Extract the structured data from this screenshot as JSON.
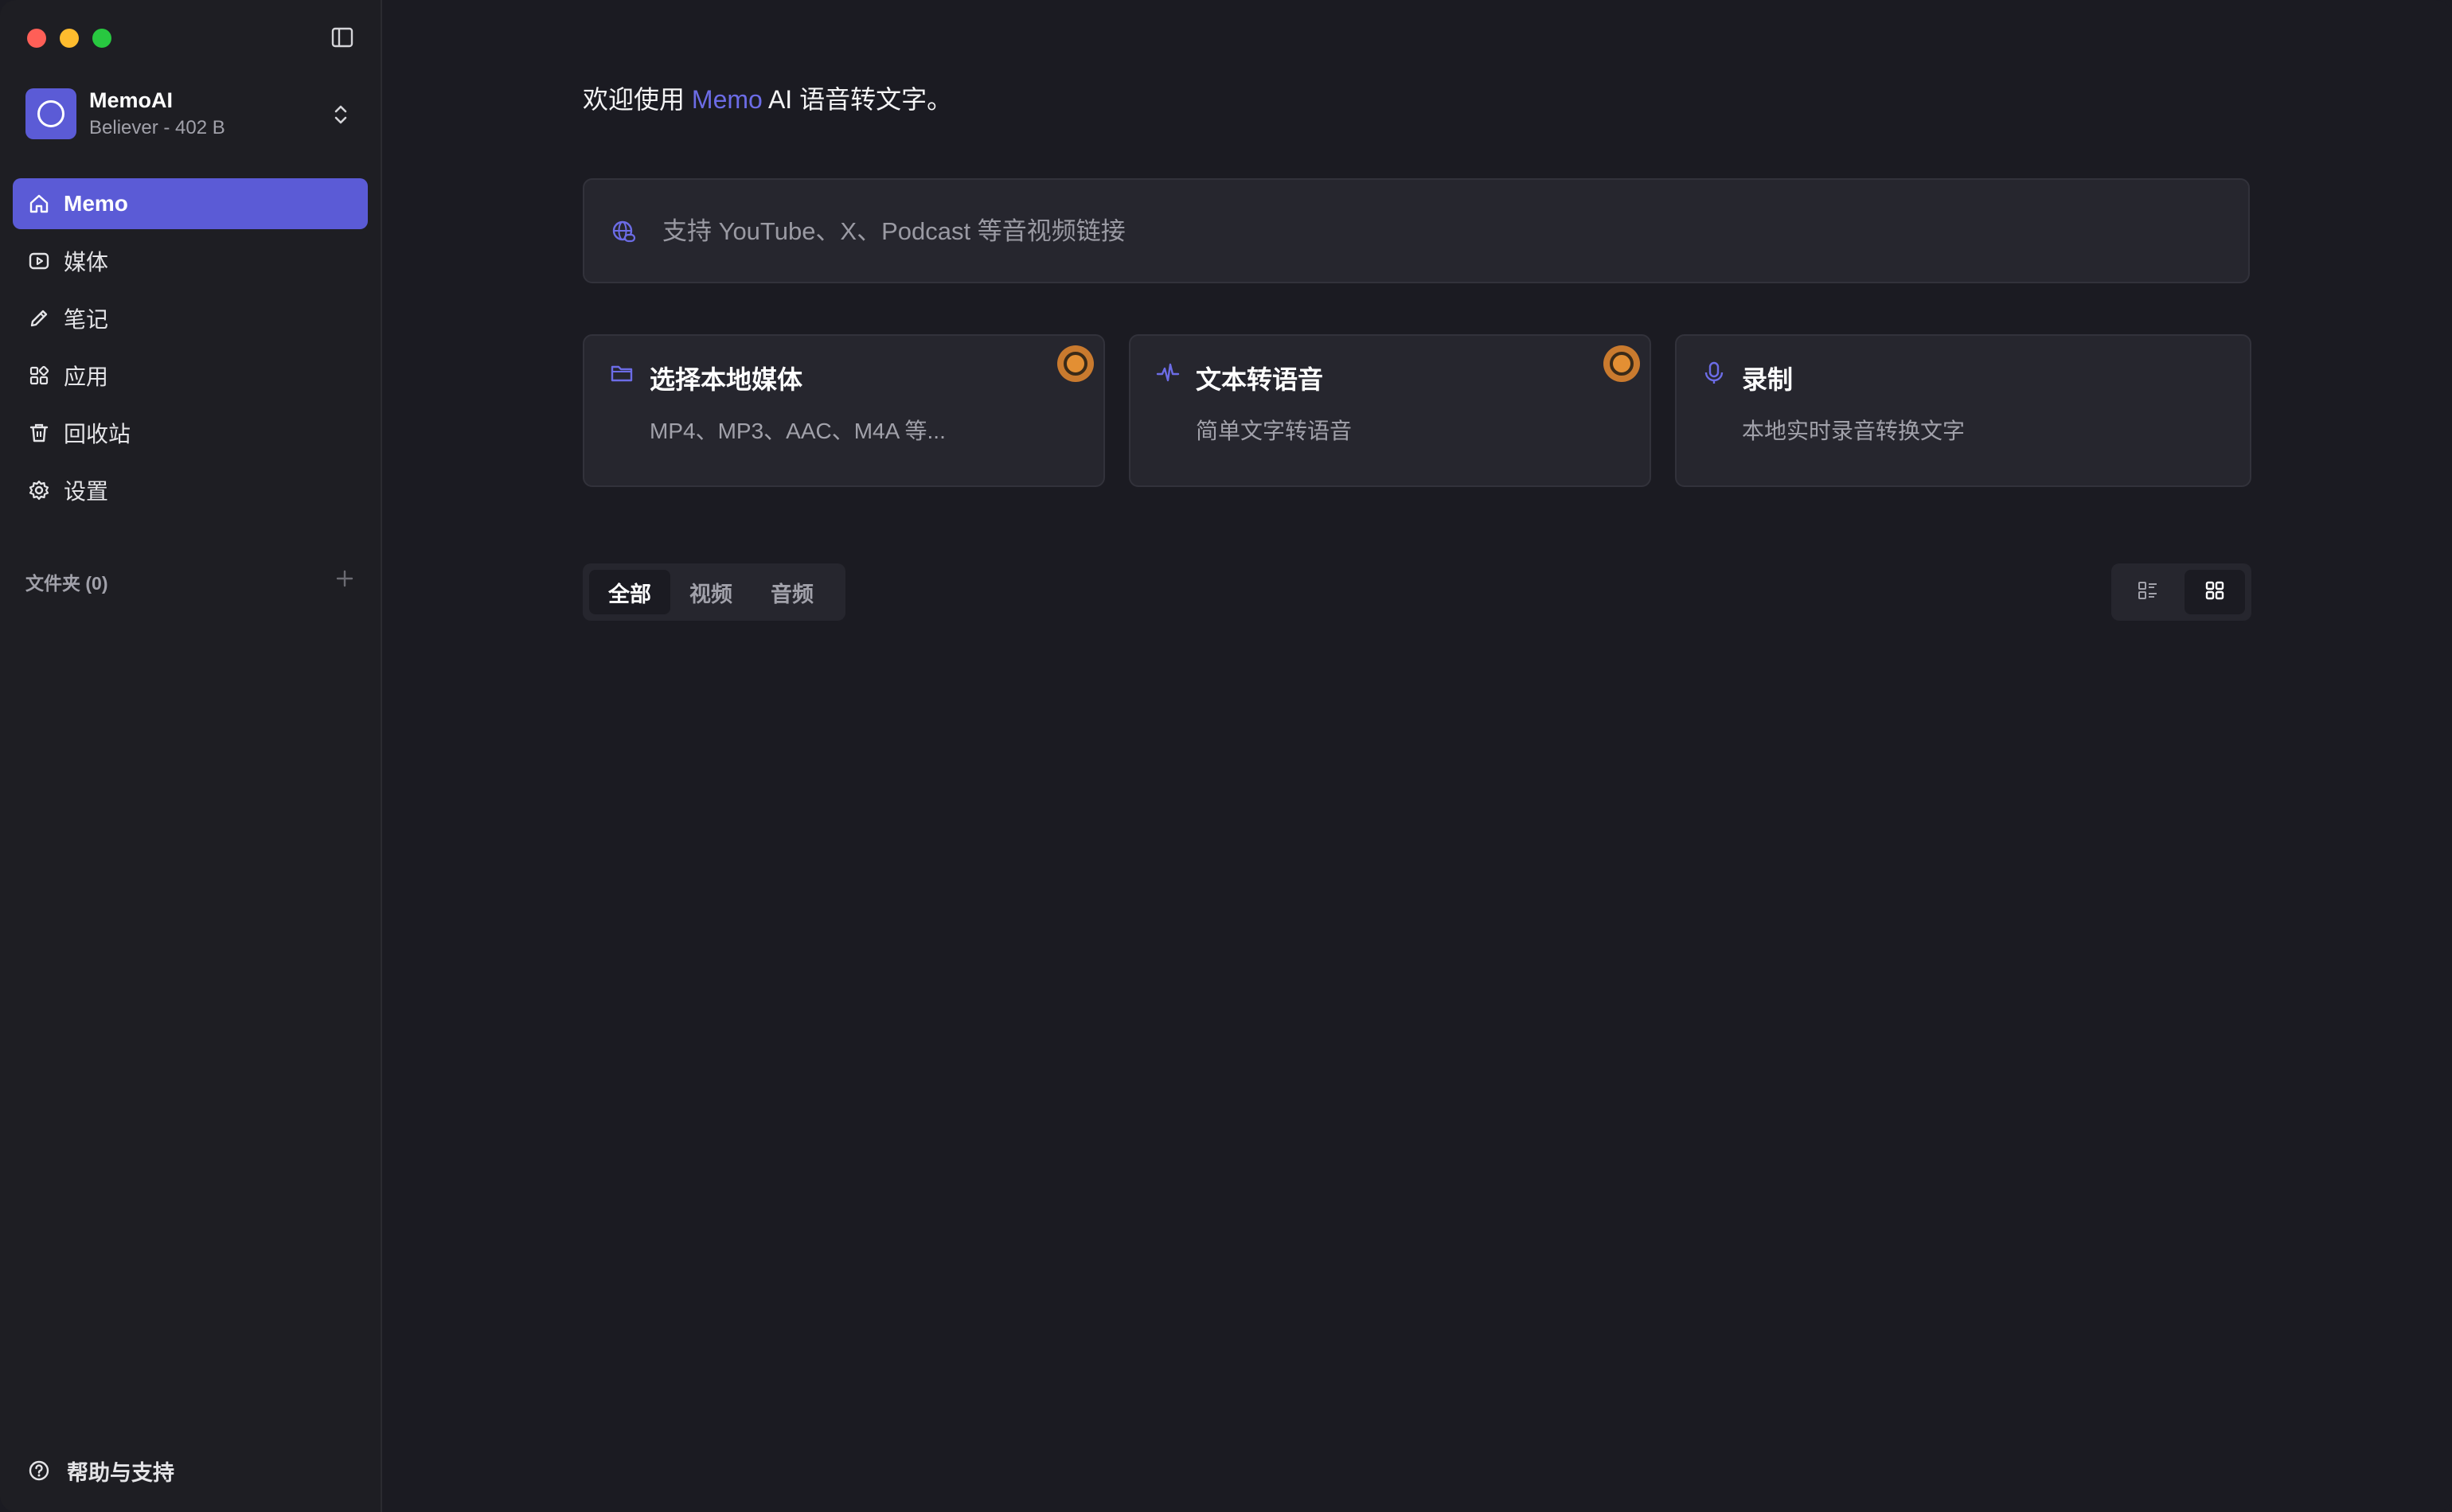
{
  "window": {
    "controls": [
      "close",
      "minimize",
      "maximize"
    ]
  },
  "sidebar": {
    "toggle_icon": "sidebar-toggle-icon",
    "account": {
      "name": "MemoAI",
      "subtitle": "Believer - 402 B"
    },
    "nav": [
      {
        "label": "Memo",
        "icon": "home-icon",
        "active": true
      },
      {
        "label": "媒体",
        "icon": "play-square-icon",
        "active": false
      },
      {
        "label": "笔记",
        "icon": "pencil-icon",
        "active": false
      },
      {
        "label": "应用",
        "icon": "apps-grid-icon",
        "active": false
      },
      {
        "label": "回收站",
        "icon": "trash-icon",
        "active": false
      },
      {
        "label": "设置",
        "icon": "gear-icon",
        "active": false
      }
    ],
    "folders": {
      "label": "文件夹 (0)"
    },
    "help": {
      "label": "帮助与支持"
    }
  },
  "main": {
    "welcome": {
      "prefix": "欢迎使用 ",
      "brand": "Memo",
      "suffix": " AI 语音转文字。"
    },
    "url_input": {
      "placeholder": "支持 YouTube、X、Podcast 等音视频链接",
      "value": ""
    },
    "cards": [
      {
        "title": "选择本地媒体",
        "desc": "MP4、MP3、AAC、M4A 等...",
        "icon": "folder-icon",
        "badge": true
      },
      {
        "title": "文本转语音",
        "desc": "简单文字转语音",
        "icon": "waveform-icon",
        "badge": true
      },
      {
        "title": "录制",
        "desc": "本地实时录音转换文字",
        "icon": "microphone-icon",
        "badge": false
      }
    ],
    "filter_tabs": [
      {
        "label": "全部",
        "active": true
      },
      {
        "label": "视频",
        "active": false
      },
      {
        "label": "音频",
        "active": false
      }
    ],
    "view_modes": [
      {
        "icon": "list-view-icon",
        "active": false
      },
      {
        "icon": "grid-view-icon",
        "active": true
      }
    ]
  },
  "colors": {
    "accent": "#5b5bd6",
    "accent_text": "#6c6ce6",
    "background": "#1b1b22",
    "sidebar": "#1e1e23",
    "card": "#26262e",
    "badge": "#c97a2e"
  }
}
